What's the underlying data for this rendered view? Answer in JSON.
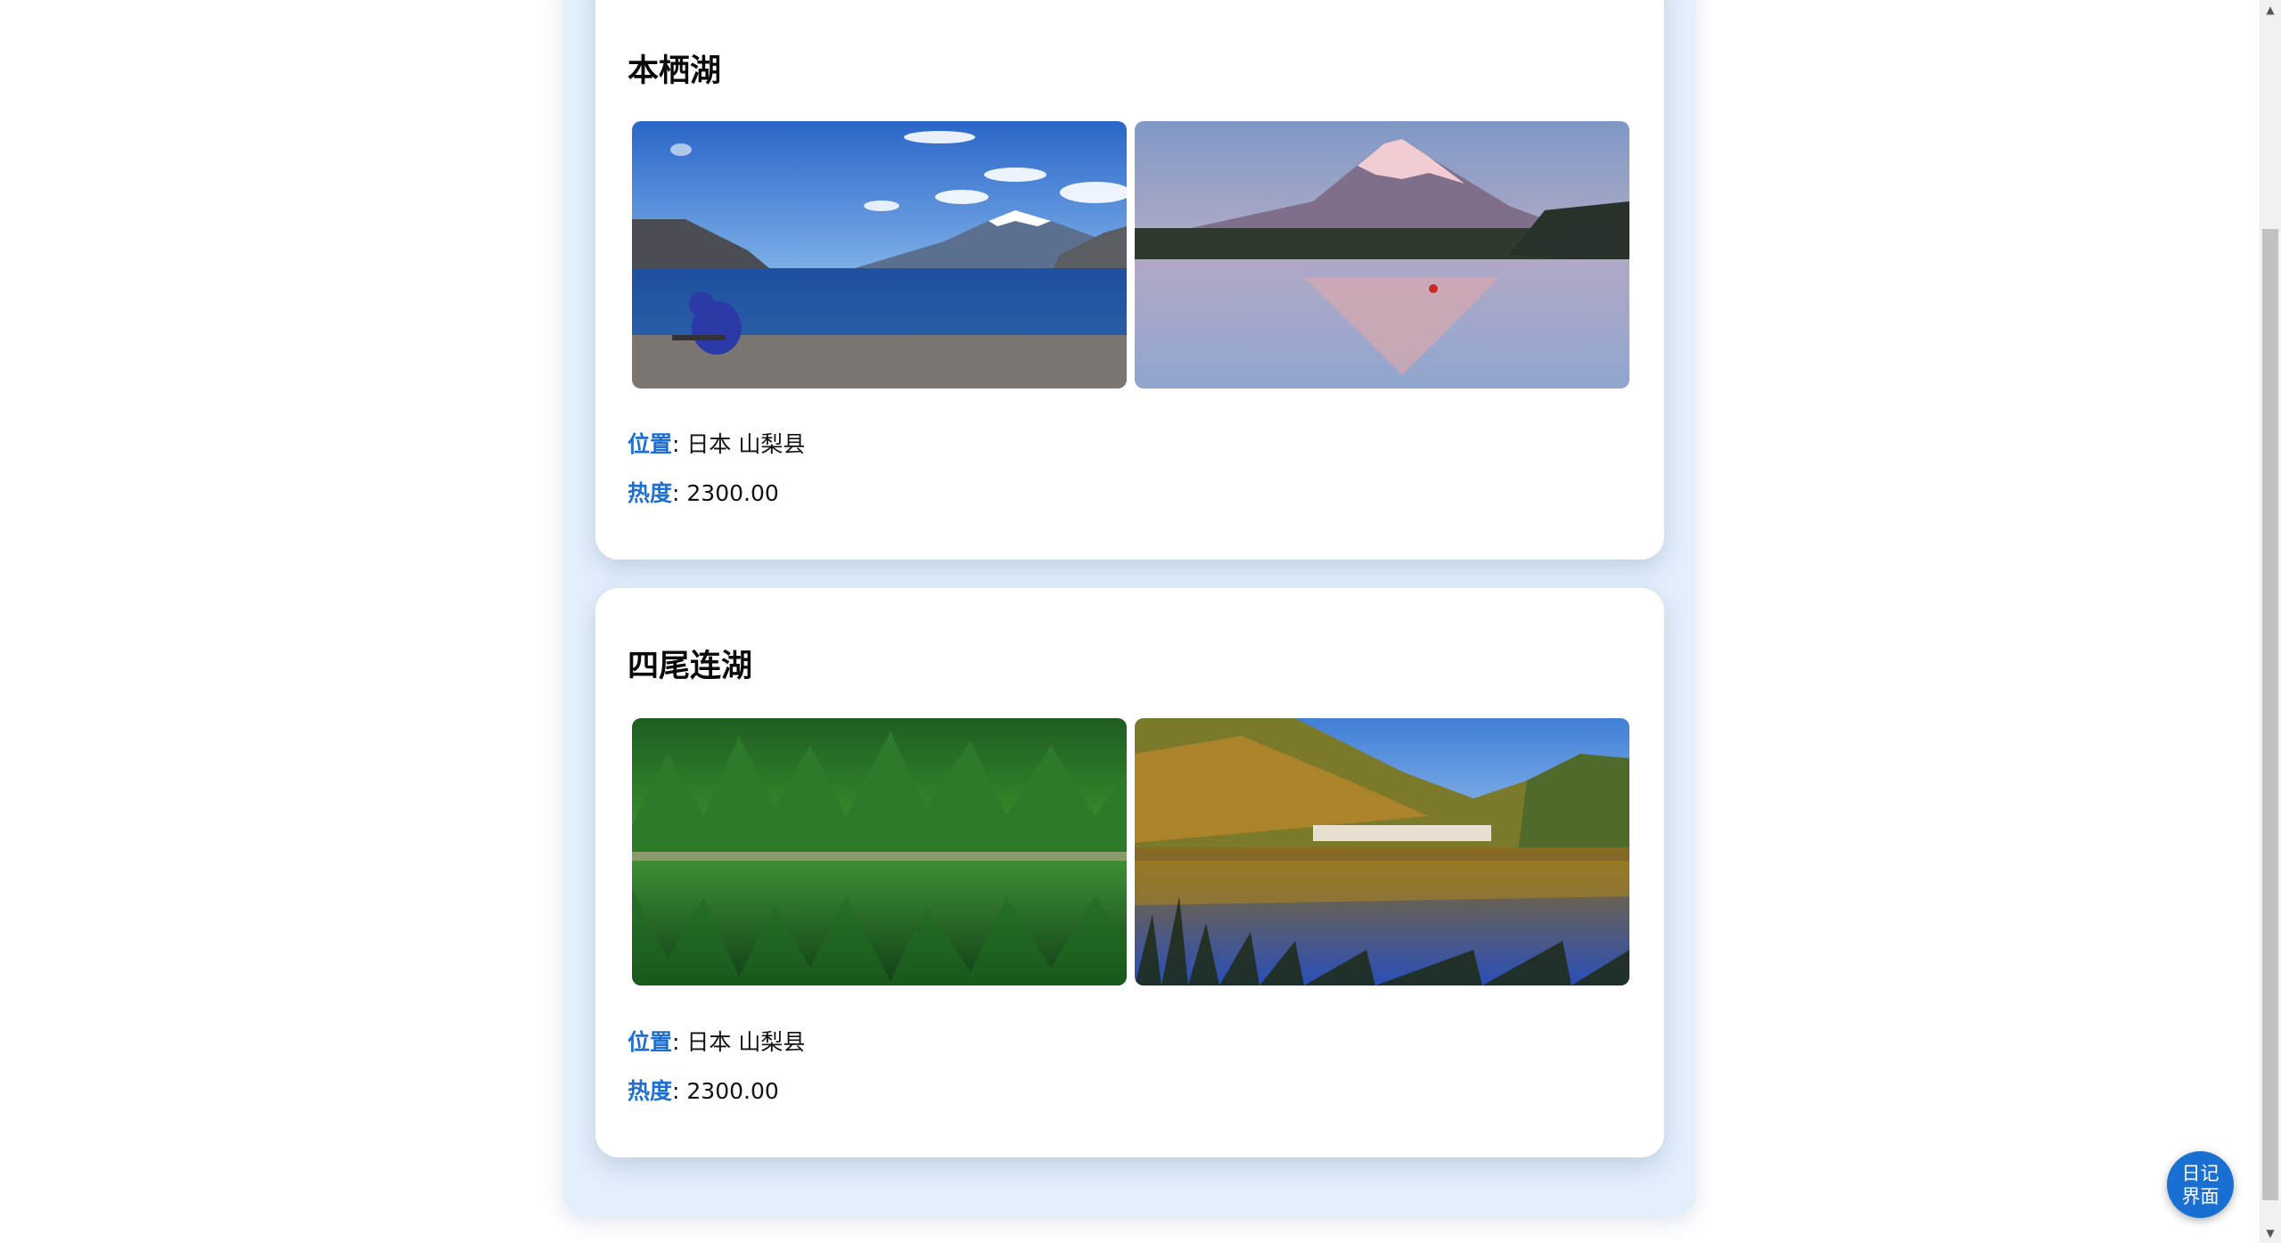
{
  "spots": [
    {
      "title": "本栖湖",
      "location_label": "位置",
      "location_value": "日本 山梨县",
      "heat_label": "热度",
      "heat_value": "2300.00",
      "photos": [
        "lake-mountain-photo",
        "mount-fuji-reflection-photo"
      ]
    },
    {
      "title": "四尾连湖",
      "location_label": "位置",
      "location_value": "日本 山梨县",
      "heat_label": "热度",
      "heat_value": "2300.00",
      "photos": [
        "green-forest-lake-photo",
        "autumn-lake-photo"
      ]
    }
  ],
  "diary_button": {
    "line1": "日记",
    "line2": "界面"
  },
  "scrollbar": {
    "up_icon": "triangle-up",
    "down_icon": "triangle-down"
  },
  "colors": {
    "accent": "#1f6fd1",
    "button": "#1a6fd2",
    "panel": "#e3effb"
  }
}
